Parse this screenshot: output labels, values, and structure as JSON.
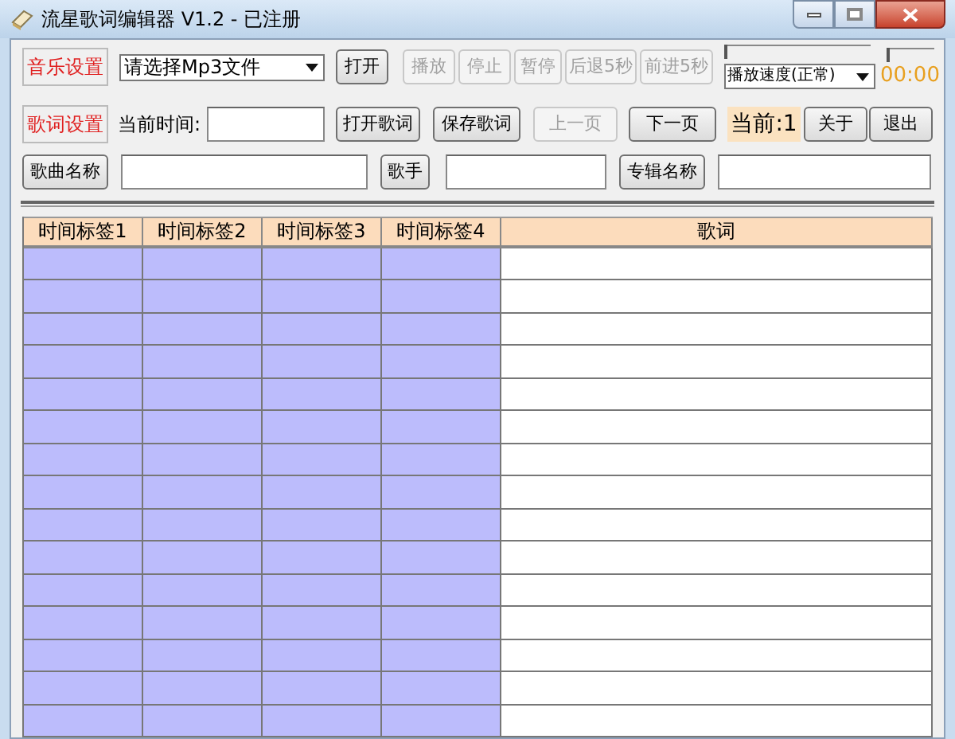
{
  "window": {
    "title": "流星歌词编辑器 V1.2 - 已注册"
  },
  "toolbar_1": {
    "music_settings": "音乐设置",
    "file_select": {
      "value": "请选择Mp3文件"
    },
    "open_button": "打开",
    "playback_buttons": [
      {
        "label": "播放",
        "disabled": true
      },
      {
        "label": "停止",
        "disabled": true
      },
      {
        "label": "暂停",
        "disabled": true
      },
      {
        "label": "后退5秒",
        "disabled": true
      },
      {
        "label": "前进5秒",
        "disabled": true
      }
    ],
    "position_slider": {
      "level": 0
    },
    "volume_slider": {
      "level": 0
    },
    "speed_select": {
      "value": "播放速度(正常)"
    },
    "time": "00:00"
  },
  "toolbar_2": {
    "lyrics_settings": "歌词设置",
    "current_time_label": "当前时间:",
    "buttons": [
      {
        "label": "打开歌词",
        "disabled": false
      },
      {
        "label": "保存歌词",
        "disabled": false
      },
      {
        "label": "上一页",
        "disabled": true
      },
      {
        "label": "下一页",
        "disabled": false
      }
    ],
    "current_page": "当前:1",
    "about_button": "关于",
    "exit_button": "退出"
  },
  "toolbar_3": {
    "song_name": "歌曲名称",
    "artist": "歌手",
    "album": "专辑名称"
  },
  "table": {
    "columns": [
      "时间标签1",
      "时间标签2",
      "时间标签3",
      "时间标签4",
      "歌词"
    ]
  }
}
